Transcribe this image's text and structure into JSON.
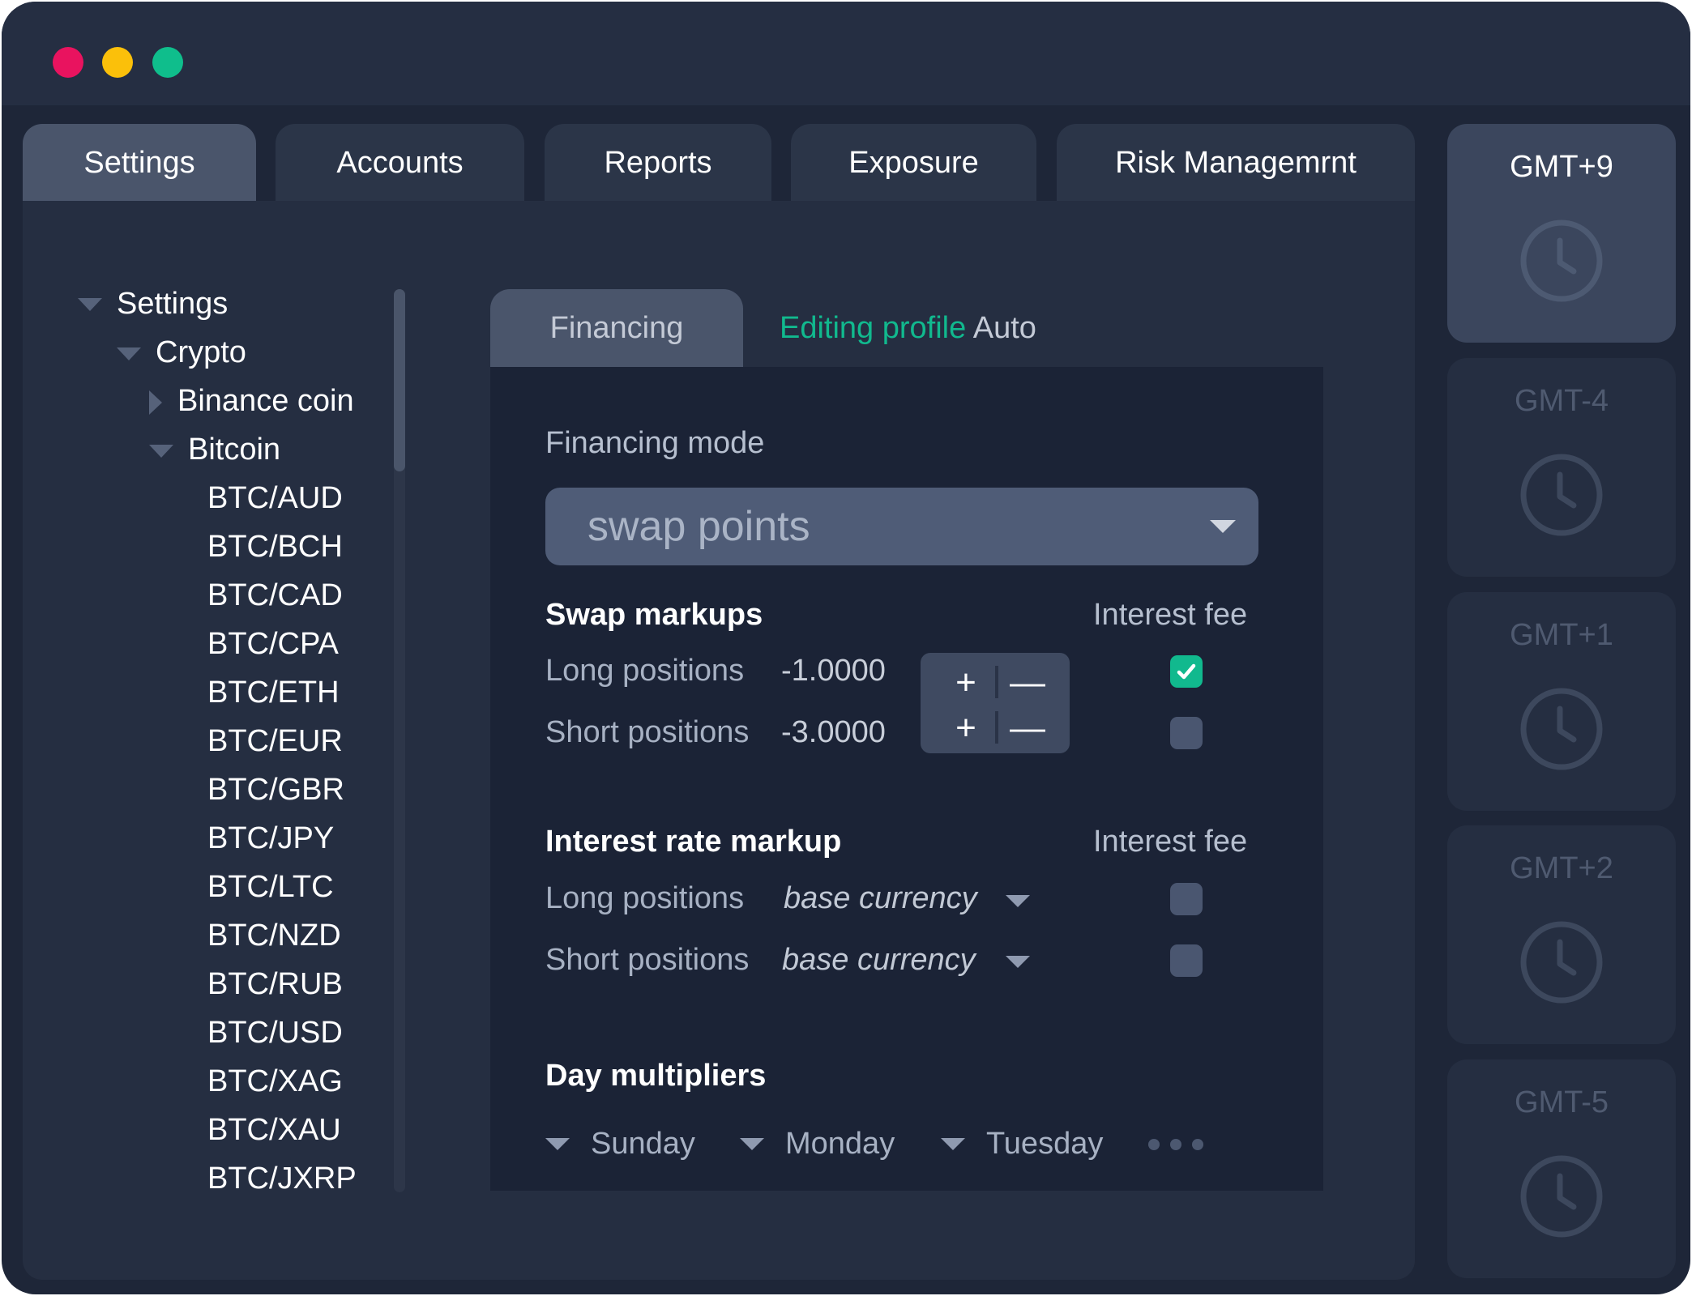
{
  "window_controls": {
    "close_color": "#e9135f",
    "minimize_color": "#fbc00a",
    "maximize_color": "#0fbe8c"
  },
  "tabs": [
    {
      "label": "Settings",
      "active": true
    },
    {
      "label": "Accounts",
      "active": false
    },
    {
      "label": "Reports",
      "active": false
    },
    {
      "label": "Exposure",
      "active": false
    },
    {
      "label": "Risk Managemrnt",
      "active": false
    }
  ],
  "tree": {
    "root": "Settings",
    "group": "Crypto",
    "collapsed_item": "Binance coin",
    "expanded_item": "Bitcoin",
    "pairs": [
      "BTC/AUD",
      "BTC/BCH",
      "BTC/CAD",
      "BTC/CPA",
      "BTC/ETH",
      "BTC/EUR",
      "BTC/GBR",
      "BTC/JPY",
      "BTC/LTC",
      "BTC/NZD",
      "BTC/RUB",
      "BTC/USD",
      "BTC/XAG",
      "BTC/XAU",
      "BTC/JXRP"
    ]
  },
  "financing": {
    "tab_label": "Financing",
    "editing_label": "Editing profile",
    "profile_name": "Auto",
    "mode_label": "Financing mode",
    "mode_value": "swap points",
    "swap_markups": {
      "title": "Swap markups",
      "fee_header": "Interest fee",
      "long_label": "Long positions",
      "long_value": "-1.0000",
      "short_label": "Short positions",
      "short_value": "-3.0000",
      "plus": "+",
      "minus": "—",
      "long_fee_checked": true,
      "short_fee_checked": false
    },
    "interest_rate": {
      "title": "Interest rate markup",
      "fee_header": "Interest fee",
      "long_label": "Long positions",
      "long_value": "base currency",
      "short_label": "Short positions",
      "short_value": "base currency",
      "long_fee_checked": false,
      "short_fee_checked": false
    },
    "day_multipliers": {
      "title": "Day multipliers",
      "days": [
        "Sunday",
        "Monday",
        "Tuesday"
      ]
    }
  },
  "accent_color": "#11b98e",
  "timezones": [
    {
      "label": "GMT+9",
      "active": true
    },
    {
      "label": "GMT-4",
      "active": false
    },
    {
      "label": "GMT+1",
      "active": false
    },
    {
      "label": "GMT+2",
      "active": false
    },
    {
      "label": "GMT-5",
      "active": false
    }
  ]
}
